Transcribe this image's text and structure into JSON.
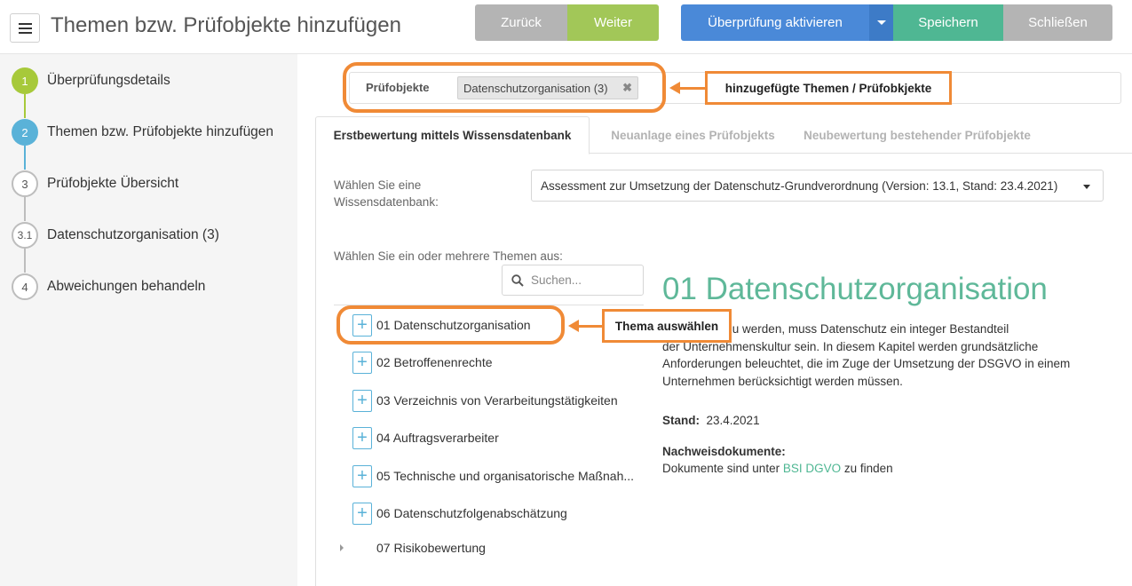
{
  "header": {
    "title": "Themen bzw. Prüfobjekte hinzufügen",
    "buttons": {
      "back": "Zurück",
      "next": "Weiter",
      "activate": "Überprüfung aktivieren",
      "save": "Speichern",
      "close": "Schließen"
    },
    "colors": {
      "next": "#a2c758",
      "activate": "#4a89d8",
      "save": "#4fb793",
      "neutral": "#b4b4b4"
    }
  },
  "sidebar": {
    "steps": [
      {
        "num": "1",
        "label": "Überprüfungsdetails",
        "state": "done"
      },
      {
        "num": "2",
        "label": "Themen bzw. Prüfobjekte hinzufügen",
        "state": "current"
      },
      {
        "num": "3",
        "label": "Prüfobjekte Übersicht",
        "state": "open"
      },
      {
        "num": "3.1",
        "label": "Datenschutzorganisation (3)",
        "state": "open"
      },
      {
        "num": "4",
        "label": "Abweichungen behandeln",
        "state": "open"
      }
    ]
  },
  "objects": {
    "label": "Prüfobjekte",
    "chip": "Datenschutzorganisation (3)",
    "chip_remove_icon": "close-icon"
  },
  "tabs": [
    {
      "label": "Erstbewertung mittels Wissensdatenbank",
      "active": true
    },
    {
      "label": "Neuanlage eines Prüfobjekts",
      "active": false
    },
    {
      "label": "Neubewertung bestehender Prüfobjekte",
      "active": false
    }
  ],
  "knowledge_base": {
    "label": "Wählen Sie eine Wissensdatenbank:",
    "selected": "Assessment zur Umsetzung der Datenschutz-Grundverordnung  (Version: 13.1, Stand: 23.4.2021)"
  },
  "topics": {
    "label": "Wählen Sie ein oder mehrere Themen aus:",
    "search_placeholder": "Suchen...",
    "items": [
      "01 Datenschutzorganisation",
      "02 Betroffenenrechte",
      "03 Verzeichnis von Verarbeitungstätigkeiten",
      "04 Auftragsverarbeiter",
      "05 Technische und organisatorische Maßnah...",
      "06 Datenschutzfolgenabschätzung",
      "07 Risikobewertung"
    ]
  },
  "detail": {
    "title": "01 Datenschutzorganisation",
    "line1": "VO gerecht zu werden, muss Datenschutz ein integer Bestandteil",
    "line2": "der Unternehmenskultur sein. In diesem Kapitel werden grundsätzliche",
    "line3": "Anforderungen beleuchtet, die im Zuge der Umsetzung der DSGVO in einem",
    "line4": "Unternehmen berücksichtigt werden müssen.",
    "stand_label": "Stand:",
    "stand_value": "23.4.2021",
    "docs_label": "Nachweisdokumente:",
    "docs_text_before": "Dokumente sind unter ",
    "docs_link": "BSI DGVO",
    "docs_text_after": " zu finden"
  },
  "annotations": {
    "objects_hint": "hinzugefügte Themen / Prüfobkjekte",
    "topic_hint": "Thema auswählen",
    "color": "#f08a36"
  }
}
